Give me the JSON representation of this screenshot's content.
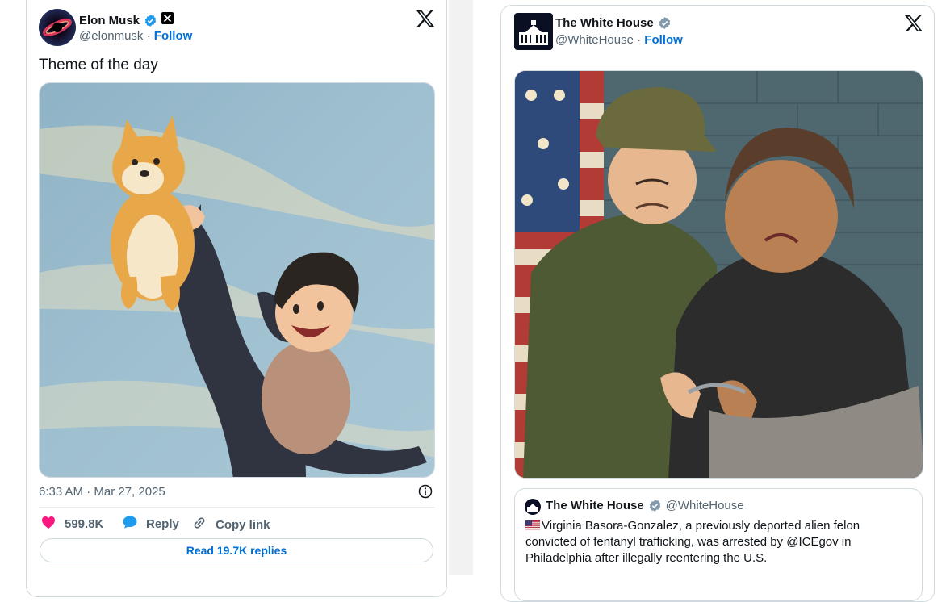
{
  "left_tweet": {
    "author": {
      "name": "Elon Musk",
      "handle": "@elonmusk",
      "follow_label": "Follow",
      "separator": "·"
    },
    "text": "Theme of the day",
    "timestamp": "6:33 AM · Mar 27, 2025",
    "actions": {
      "like_count": "599.8K",
      "reply_label": "Reply",
      "copy_link_label": "Copy link"
    },
    "read_replies_label": "Read 19.7K replies"
  },
  "right_tweet": {
    "author": {
      "name": "The White House",
      "handle": "@WhiteHouse",
      "follow_label": "Follow",
      "separator": "·"
    },
    "quoted": {
      "author_name": "The White House",
      "author_handle": "@WhiteHouse",
      "text": "Virginia Basora-Gonzalez, a previously deported alien felon convicted of fentanyl trafficking, was arrested by @ICEgov in Philadelphia after illegally reentering the U.S."
    }
  },
  "colors": {
    "link_blue": "#006fd6",
    "like_pink": "#f91880",
    "border": "#cfd9de",
    "muted_text": "#536471",
    "verified_blue": "#1d9bf0"
  },
  "icons": [
    "verified-badge-icon",
    "x-logo-icon",
    "heart-icon",
    "reply-bubble-icon",
    "link-icon",
    "info-icon",
    "us-flag-icon"
  ]
}
